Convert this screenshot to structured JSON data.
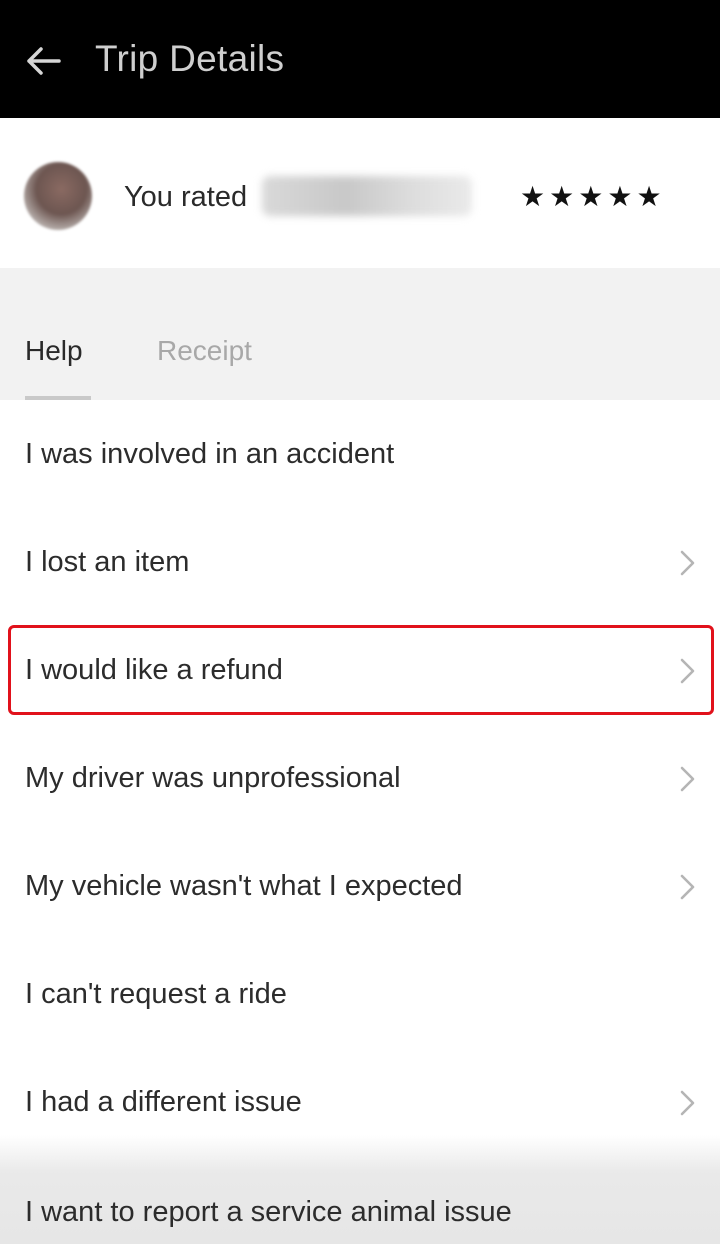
{
  "header": {
    "title": "Trip Details",
    "back_icon": "arrow-left-icon"
  },
  "rating": {
    "label": "You rated",
    "driver_name": "",
    "stars": [
      "★",
      "★",
      "★",
      "★",
      "★"
    ]
  },
  "tabs": {
    "help": "Help",
    "receipt": "Receipt",
    "active": "Help"
  },
  "help_items": [
    {
      "label": "I was involved in an accident",
      "has_chevron": false
    },
    {
      "label": "I lost an item",
      "has_chevron": true
    },
    {
      "label": "I would like a refund",
      "has_chevron": true,
      "highlighted": true
    },
    {
      "label": "My driver was unprofessional",
      "has_chevron": true
    },
    {
      "label": "My vehicle wasn't what I expected",
      "has_chevron": true
    },
    {
      "label": "I can't request a ride",
      "has_chevron": false
    },
    {
      "label": "I had a different issue",
      "has_chevron": true
    },
    {
      "label": "I want to report a service animal issue",
      "has_chevron": false
    }
  ],
  "colors": {
    "header_bg": "#000000",
    "highlight": "#e1111b",
    "tabs_bg": "#f2f2f2"
  }
}
